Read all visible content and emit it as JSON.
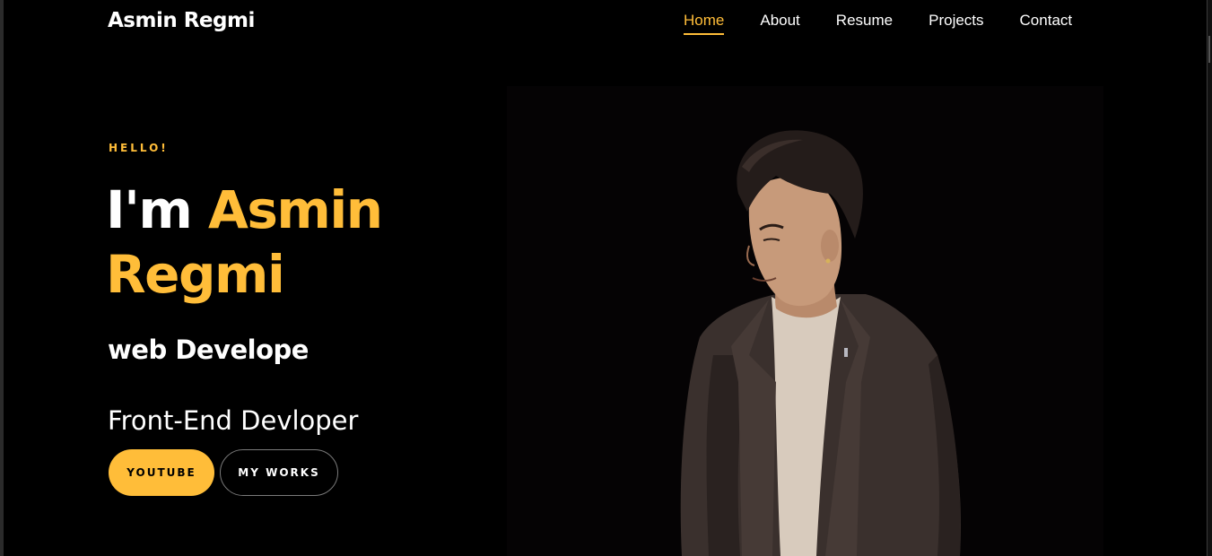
{
  "brand": "Asmin Regmi",
  "nav": {
    "items": [
      "Home",
      "About",
      "Resume",
      "Projects",
      "Contact"
    ],
    "active": "Home"
  },
  "hero": {
    "greeting": "HELLO!",
    "intro": "I'm",
    "first_name": "Asmin",
    "last_name": "Regmi",
    "role": "web Develope",
    "typed_text": "Front-End Devloper",
    "buttons": {
      "youtube": "YOUTUBE",
      "works": "MY WORKS"
    }
  },
  "colors": {
    "accent": "#ffbd39",
    "background": "#000000",
    "text": "#ffffff"
  },
  "image": {
    "subject": "portrait-photo"
  }
}
